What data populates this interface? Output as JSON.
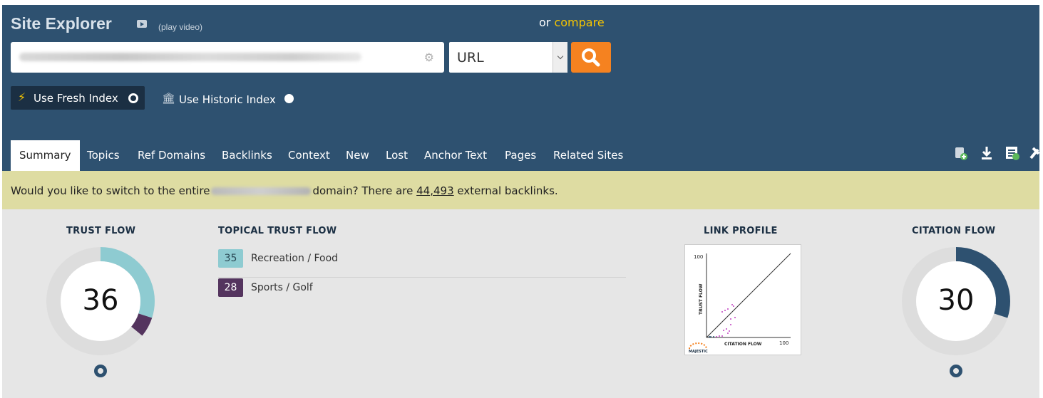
{
  "header": {
    "title": "Site Explorer",
    "play_video": "(play video)",
    "or_text": "or",
    "compare_link": "compare"
  },
  "search": {
    "value": "",
    "scope_selected": "URL"
  },
  "index": {
    "fresh_label": "Use Fresh Index",
    "historic_label": "Use Historic Index",
    "selected": "fresh"
  },
  "tabs": [
    {
      "label": "Summary",
      "active": true
    },
    {
      "label": "Topics"
    },
    {
      "label": "Ref Domains"
    },
    {
      "label": "Backlinks"
    },
    {
      "label": "Context"
    },
    {
      "label": "New"
    },
    {
      "label": "Lost"
    },
    {
      "label": "Anchor Text"
    },
    {
      "label": "Pages"
    },
    {
      "label": "Related Sites"
    }
  ],
  "toolbar": {
    "icons": [
      "add-to-bucket-icon",
      "download-icon",
      "report-icon",
      "tools-icon"
    ]
  },
  "banner": {
    "prefix": "Would you like to switch to the entire",
    "middle": "domain? There are",
    "count": "44,493",
    "suffix": "external backlinks."
  },
  "trust_flow": {
    "title": "TRUST FLOW",
    "value": "36",
    "segments": [
      {
        "topic": "Recreation / Food",
        "value": 35,
        "color": "#8ecbd1"
      },
      {
        "topic": "Sports / Golf",
        "value": 28,
        "color": "#54345e"
      }
    ]
  },
  "topical_trust_flow": {
    "title": "TOPICAL TRUST FLOW",
    "topics": [
      {
        "value": "35",
        "label": "Recreation / Food",
        "color": "#8ecbd1"
      },
      {
        "value": "28",
        "label": "Sports / Golf",
        "color": "#54345e"
      }
    ]
  },
  "link_profile": {
    "title": "LINK PROFILE",
    "ylabel": "TRUST FLOW",
    "xlabel": "CITATION FLOW",
    "y_max": "100",
    "x_max": "100",
    "brand": "MAJESTIC"
  },
  "citation_flow": {
    "title": "CITATION FLOW",
    "value": "30",
    "color": "#2e5170"
  },
  "colors": {
    "header_bg": "#2e5170",
    "accent_orange": "#f58220",
    "compare_yellow": "#f6c500",
    "banner_bg": "#dedca2"
  }
}
